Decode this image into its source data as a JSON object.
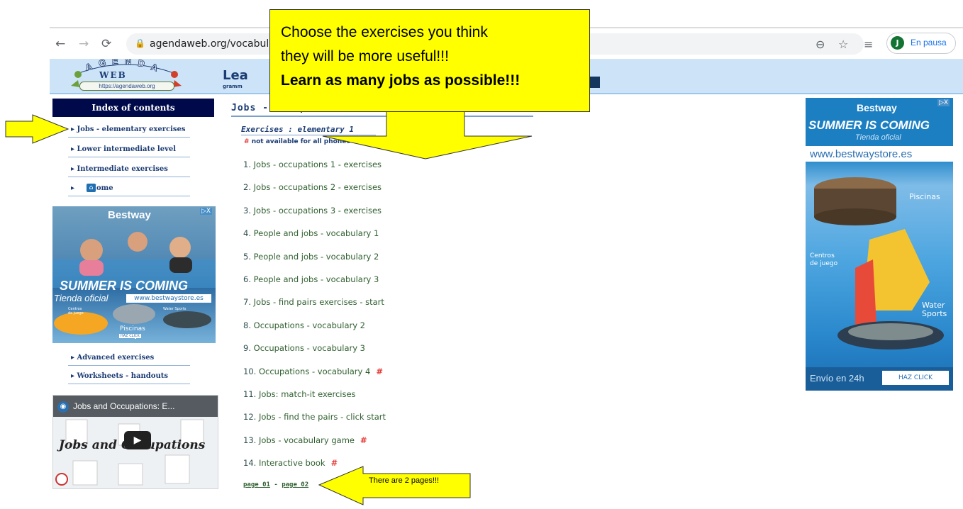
{
  "browser": {
    "url": "agendaweb.org/vocabula",
    "profile_initial": "J",
    "profile_status": "En pausa"
  },
  "header": {
    "logo_text": "AGENDA WEB",
    "logo_web": "WEB",
    "logo_url": "https://agendaweb.org",
    "title": "Lea",
    "subtitle": "gramm"
  },
  "sidebar": {
    "index_title": "Index of contents",
    "items": [
      {
        "label": "Jobs - elementary exercises"
      },
      {
        "label": "Lower intermediate level"
      },
      {
        "label": "Intermediate exercises"
      },
      {
        "label": "Home"
      }
    ],
    "bottom_items": [
      {
        "label": "Advanced exercises"
      },
      {
        "label": "Worksheets - handouts"
      }
    ]
  },
  "ad_left": {
    "brand": "Bestway",
    "headline": "SUMMER IS COMING",
    "sub": "Tienda oficial",
    "site": "www.bestwaystore.es",
    "label_a": "Centros de juego",
    "label_b": "Water Sports",
    "label_c": "Piscinas",
    "cta": "HAZ CLICK"
  },
  "ad_right": {
    "brand": "Bestway",
    "headline": "SUMMER IS COMING",
    "sub": "Tienda oficial",
    "site": "www.bestwaystore.es",
    "label_piscinas": "Piscinas",
    "label_centros_1": "Centros",
    "label_centros_2": "de juego",
    "label_water_1": "Water",
    "label_water_2": "Sports",
    "shipping": "Envío en 24h",
    "cta": "HAZ CLICK"
  },
  "video": {
    "title": "Jobs and Occupations: E...",
    "overlay": "Jobs and Occupations"
  },
  "main": {
    "heading": "Jobs - occupations",
    "exercises_heading": "Exercises : elementary 1",
    "note_hash": "#",
    "note": "not available for all phones",
    "items": [
      {
        "num": "1.",
        "label": "Jobs - occupations 1 - exercises",
        "hash": ""
      },
      {
        "num": "2.",
        "label": "Jobs - occupations 2 - exercises",
        "hash": ""
      },
      {
        "num": "3.",
        "label": "Jobs - occupations 3 - exercises",
        "hash": ""
      },
      {
        "num": "4.",
        "label": "People and jobs - vocabulary 1",
        "hash": ""
      },
      {
        "num": "5.",
        "label": "People and jobs - vocabulary 2",
        "hash": ""
      },
      {
        "num": "6.",
        "label": "People and jobs - vocabulary 3",
        "hash": ""
      },
      {
        "num": "7.",
        "label": "Jobs - find pairs exercises - start",
        "hash": ""
      },
      {
        "num": "8.",
        "label": "Occupations - vocabulary 2",
        "hash": ""
      },
      {
        "num": "9.",
        "label": "Occupations - vocabulary 3",
        "hash": ""
      },
      {
        "num": "10.",
        "label": "Occupations - vocabulary 4",
        "hash": "#"
      },
      {
        "num": "11.",
        "label": "Jobs: match-it exercises",
        "hash": ""
      },
      {
        "num": "12.",
        "label": "Jobs - find the pairs - click start",
        "hash": ""
      },
      {
        "num": "13.",
        "label": "Jobs - vocabulary game",
        "hash": "#"
      },
      {
        "num": "14.",
        "label": "Interactive book",
        "hash": "#"
      }
    ],
    "page_01": "page 01",
    "page_sep": " - ",
    "page_02": "page 02"
  },
  "callouts": {
    "main_line1": "Choose the exercises you think",
    "main_line2": "they will be more useful!!!",
    "main_line3": "Learn as many jobs as possible!!!",
    "pages_note": "There are 2 pages!!!"
  },
  "colors": {
    "callout": "#ffff00",
    "header_bg": "#cde4f8",
    "index_head": "#000a4a",
    "link_blue": "#1b3c74",
    "hash_red": "#e53935"
  }
}
